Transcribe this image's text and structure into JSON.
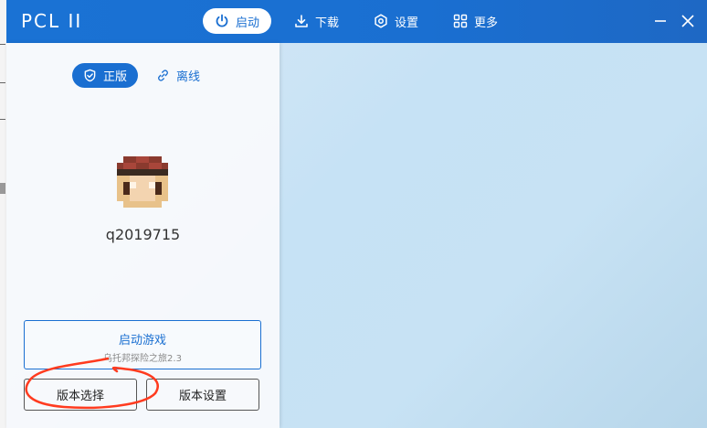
{
  "app": {
    "title": "PCL II"
  },
  "nav": [
    {
      "label": "启动",
      "icon": "power-icon",
      "active": true
    },
    {
      "label": "下载",
      "icon": "download-icon",
      "active": false
    },
    {
      "label": "设置",
      "icon": "gear-icon",
      "active": false
    },
    {
      "label": "更多",
      "icon": "grid-icon",
      "active": false
    }
  ],
  "window_controls": {
    "minimize": "minimize-icon",
    "close": "close-icon"
  },
  "modes": [
    {
      "label": "正版",
      "icon": "shield-icon",
      "active": true
    },
    {
      "label": "离线",
      "icon": "link-icon",
      "active": false
    }
  ],
  "user": {
    "name": "q2019715"
  },
  "launch": {
    "label": "启动游戏",
    "subtitle": "乌托邦探险之旅2.3"
  },
  "buttons": {
    "version_select": "版本选择",
    "version_settings": "版本设置"
  },
  "colors": {
    "accent": "#1a6fd1",
    "annotation": "#ff3b1f"
  }
}
